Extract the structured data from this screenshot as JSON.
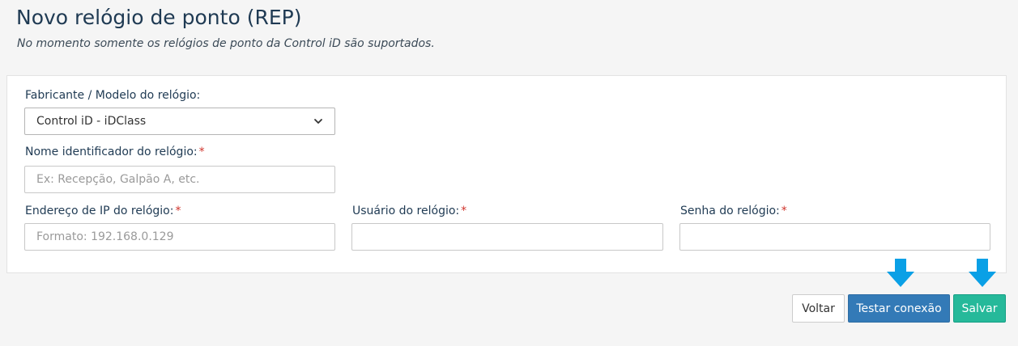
{
  "header": {
    "title": "Novo relógio de ponto (REP)",
    "subtitle": "No momento somente os relógios de ponto da Control iD são suportados."
  },
  "form": {
    "model": {
      "label": "Fabricante / Modelo do relógio:",
      "selected": "Control iD - iDClass",
      "icon": "chevron-down-icon"
    },
    "name": {
      "label": "Nome identificador do relógio:",
      "required": "*",
      "placeholder": "Ex: Recepção, Galpão A, etc.",
      "value": ""
    },
    "ip": {
      "label": "Endereço de IP do relógio:",
      "required": "*",
      "placeholder": "Formato: 192.168.0.129",
      "value": ""
    },
    "user": {
      "label": "Usuário do relógio:",
      "required": "*",
      "placeholder": "",
      "value": ""
    },
    "password": {
      "label": "Senha do relógio:",
      "required": "*",
      "placeholder": "",
      "value": ""
    }
  },
  "actions": {
    "back_label": "Voltar",
    "test_label": "Testar conexão",
    "save_label": "Salvar"
  },
  "colors": {
    "primary": "#337ab7",
    "success": "#26b99a",
    "arrow": "#0aa0e6",
    "required": "#d0342c",
    "title": "#1f3a53"
  },
  "annotations": {
    "arrow_icon": "arrow-down-icon"
  }
}
